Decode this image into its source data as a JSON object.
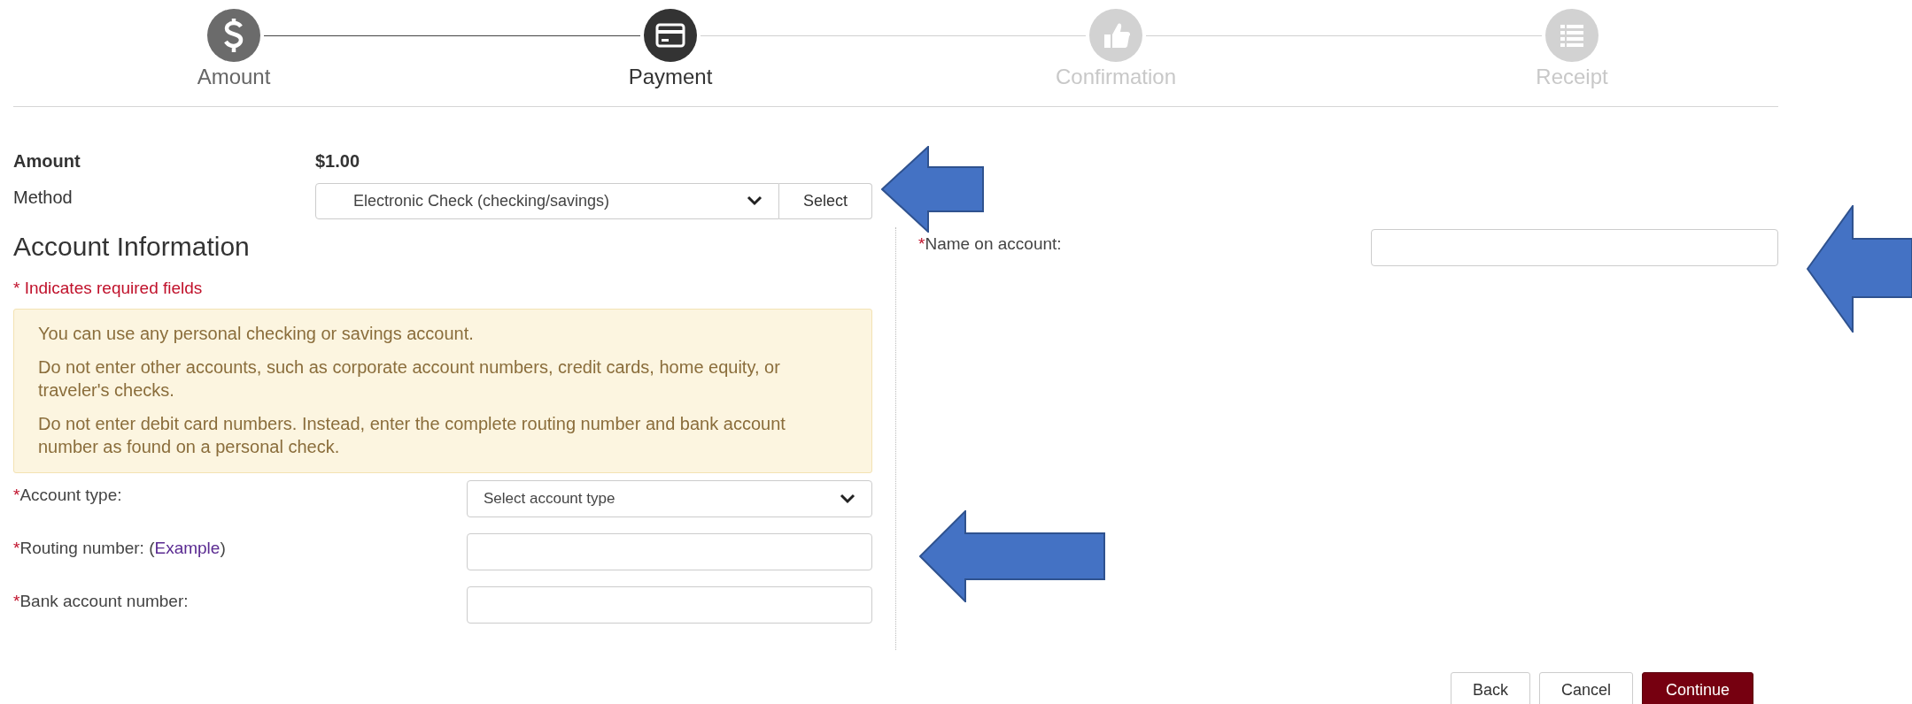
{
  "steps": [
    {
      "label": "Amount",
      "completed": true,
      "selected": false
    },
    {
      "label": "Payment",
      "completed": false,
      "selected": true
    },
    {
      "label": "Confirmation",
      "completed": false,
      "selected": false
    },
    {
      "label": "Receipt",
      "completed": false,
      "selected": false
    }
  ],
  "summary": {
    "amount_label": "Amount",
    "amount_value": "$1.00",
    "method_label": "Method",
    "method_value": "Electronic Check (checking/savings)",
    "method_button": "Select"
  },
  "account_info": {
    "heading": "Account Information",
    "required_note": "* Indicates required fields",
    "notice": [
      "You can use any personal checking or savings account.",
      "Do not enter other accounts, such as corporate account numbers, credit cards, home equity, or traveler's checks.",
      "Do not enter debit card numbers. Instead, enter the complete routing number and bank account number as found on a personal check."
    ],
    "fields": [
      {
        "kind": "select",
        "marker": "*",
        "label": "Account type:",
        "value": "Select account type"
      },
      {
        "kind": "input",
        "marker": "*",
        "label": "Routing number: (",
        "link": "Example",
        "label_end": ")"
      },
      {
        "kind": "input",
        "marker": "*",
        "label": "Bank account number:"
      }
    ]
  },
  "right_fields": [
    {
      "kind": "input",
      "marker": "*",
      "label": "Name on account:"
    }
  ],
  "buttons": [
    {
      "label": "Back",
      "kind": "secondary"
    },
    {
      "label": "Cancel",
      "kind": "secondary"
    },
    {
      "label": "Continue",
      "kind": "primary"
    }
  ]
}
